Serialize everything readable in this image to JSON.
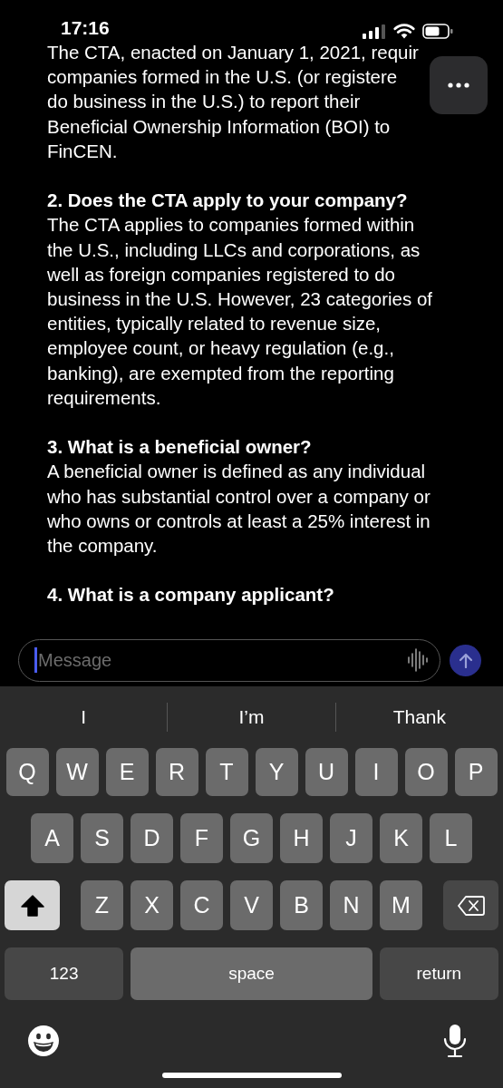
{
  "status_bar": {
    "time": "17:16"
  },
  "conversation": {
    "blocks": [
      {
        "kind": "body",
        "text": "The CTA, enacted on January 1, 2021, requir\ncompanies formed in the U.S. (or registere\ndo business in the U.S.) to report their\nBeneficial Ownership Information (BOI) to\nFinCEN."
      },
      {
        "kind": "heading",
        "text": "2. Does the CTA apply to your company?"
      },
      {
        "kind": "body",
        "text": "The CTA applies to companies formed within\nthe U.S., including LLCs and corporations, as\nwell as foreign companies registered to do\nbusiness in the U.S. However, 23 categories of\nentities, typically related to revenue size,\nemployee count, or heavy regulation (e.g.,\nbanking), are exempted from the reporting\nrequirements."
      },
      {
        "kind": "heading",
        "text": "3. What is a beneficial owner?"
      },
      {
        "kind": "body",
        "text": "A beneficial owner is defined as any individual\nwho has substantial control over a company or\nwho owns or controls at least a 25% interest in\nthe company."
      },
      {
        "kind": "heading",
        "text": "4. What is a company applicant?"
      }
    ]
  },
  "composer": {
    "placeholder": "Message",
    "focused": true
  },
  "suggestions": [
    "I",
    "I’m",
    "Thank"
  ],
  "keyboard": {
    "shift_on": true,
    "rows": [
      [
        "Q",
        "W",
        "E",
        "R",
        "T",
        "Y",
        "U",
        "I",
        "O",
        "P"
      ],
      [
        "A",
        "S",
        "D",
        "F",
        "G",
        "H",
        "J",
        "K",
        "L"
      ],
      [
        "Z",
        "X",
        "C",
        "V",
        "B",
        "N",
        "M"
      ]
    ],
    "numbers_key": "123",
    "space_key": "space",
    "return_key": "return"
  }
}
